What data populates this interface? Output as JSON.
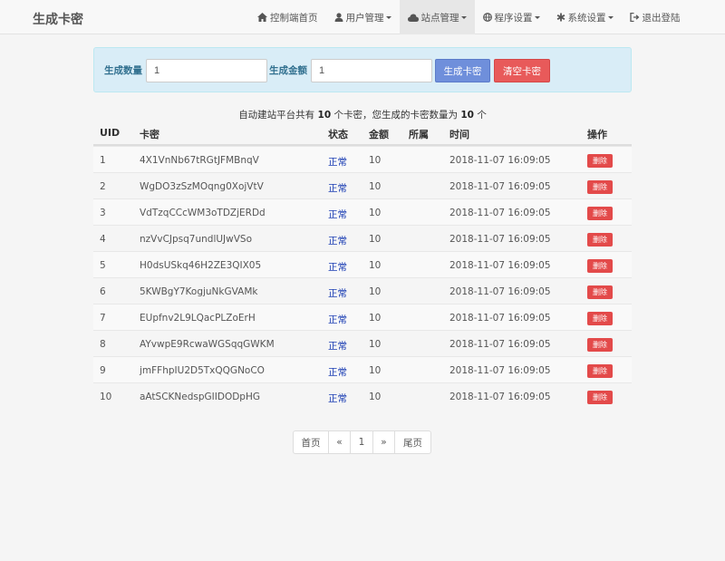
{
  "brand": "生成卡密",
  "nav": {
    "dashboard": "控制端首页",
    "users": "用户管理",
    "sites": "站点管理",
    "program": "程序设置",
    "system": "系统设置",
    "logout": "退出登陆"
  },
  "form": {
    "qty_label": "生成数量",
    "qty_value": "1",
    "amount_label": "生成金额",
    "amount_value": "1",
    "generate_label": "生成卡密",
    "clear_label": "清空卡密"
  },
  "summary": {
    "prefix": "自动建站平台共有",
    "total": "10",
    "middle": "个卡密，您生成的卡密数量为",
    "mine": "10",
    "suffix": "个"
  },
  "table": {
    "headers": {
      "uid": "UID",
      "card": "卡密",
      "status": "状态",
      "amount": "金额",
      "owner": "所属",
      "time": "时间",
      "action": "操作"
    },
    "rows": [
      {
        "uid": "1",
        "card": "4X1VnNb67tRGtJFMBnqV",
        "status": "正常",
        "amount": "10",
        "owner": "",
        "time": "2018-11-07 16:09:05",
        "action": "删除"
      },
      {
        "uid": "2",
        "card": "WgDO3zSzMOqng0XojVtV",
        "status": "正常",
        "amount": "10",
        "owner": "",
        "time": "2018-11-07 16:09:05",
        "action": "删除"
      },
      {
        "uid": "3",
        "card": "VdTzqCCcWM3oTDZjERDd",
        "status": "正常",
        "amount": "10",
        "owner": "",
        "time": "2018-11-07 16:09:05",
        "action": "删除"
      },
      {
        "uid": "4",
        "card": "nzVvCJpsq7undlUJwVSo",
        "status": "正常",
        "amount": "10",
        "owner": "",
        "time": "2018-11-07 16:09:05",
        "action": "删除"
      },
      {
        "uid": "5",
        "card": "H0dsUSkq46H2ZE3QIX05",
        "status": "正常",
        "amount": "10",
        "owner": "",
        "time": "2018-11-07 16:09:05",
        "action": "删除"
      },
      {
        "uid": "6",
        "card": "5KWBgY7KogjuNkGVAMk",
        "status": "正常",
        "amount": "10",
        "owner": "",
        "time": "2018-11-07 16:09:05",
        "action": "删除"
      },
      {
        "uid": "7",
        "card": "EUpfnv2L9LQacPLZoErH",
        "status": "正常",
        "amount": "10",
        "owner": "",
        "time": "2018-11-07 16:09:05",
        "action": "删除"
      },
      {
        "uid": "8",
        "card": "AYvwpE9RcwaWGSqqGWKM",
        "status": "正常",
        "amount": "10",
        "owner": "",
        "time": "2018-11-07 16:09:05",
        "action": "删除"
      },
      {
        "uid": "9",
        "card": "jmFFhpIU2D5TxQQGNoCO",
        "status": "正常",
        "amount": "10",
        "owner": "",
        "time": "2018-11-07 16:09:05",
        "action": "删除"
      },
      {
        "uid": "10",
        "card": "aAtSCKNedspGIIDODpHG",
        "status": "正常",
        "amount": "10",
        "owner": "",
        "time": "2018-11-07 16:09:05",
        "action": "删除"
      }
    ]
  },
  "pagination": {
    "first": "首页",
    "prev": "«",
    "current": "1",
    "next": "»",
    "last": "尾页"
  },
  "colors": {
    "status_text": "#1a3db3",
    "delete_button": "#e34a4a",
    "generate_button": "#6f8fdb",
    "clear_button": "#e85a5a",
    "panel_bg": "#d9edf7"
  },
  "icons": {
    "dashboard": "home-icon",
    "users": "user-icon",
    "sites": "cloud-icon",
    "program": "globe-icon",
    "system": "asterisk-icon",
    "logout": "logout-icon"
  }
}
